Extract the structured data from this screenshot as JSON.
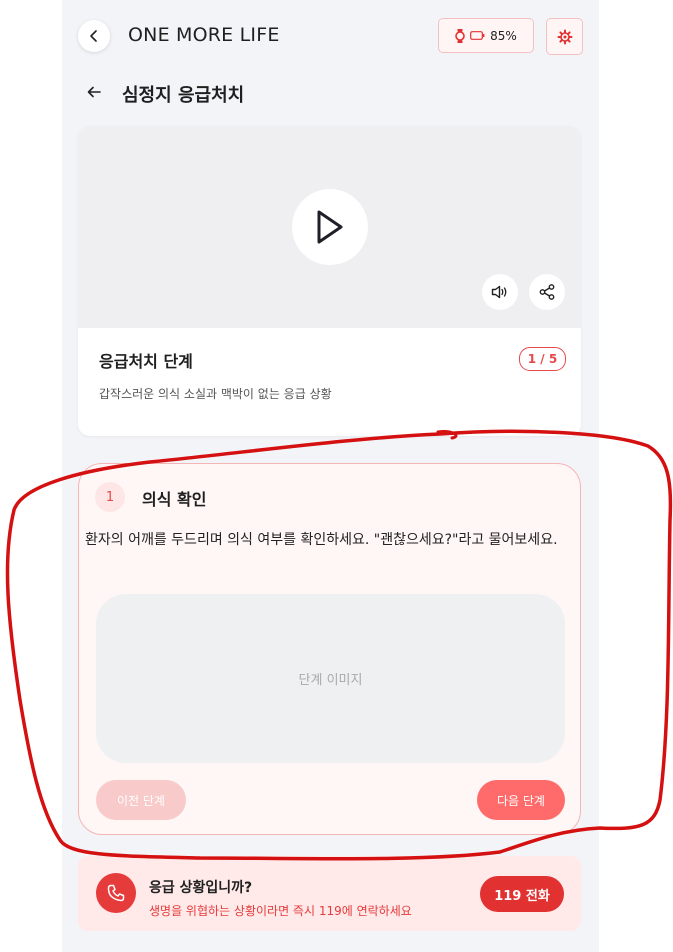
{
  "header": {
    "app_title": "ONE MORE LIFE",
    "battery_text": "85%",
    "battery_level": 0.85
  },
  "subnav": {
    "title": "심정지 응급처치"
  },
  "video_section": {
    "title": "응급처치 단계",
    "step_counter": "1 / 5",
    "description": "갑작스러운 의식 소실과 맥박이 없는 응급 상황"
  },
  "step": {
    "number": "1",
    "title": "의식 확인",
    "description": "환자의 어깨를 두드리며 의식 여부를 확인하세요. \"괜찮으세요?\"라고 물어보세요.",
    "image_placeholder": "단계 이미지",
    "prev_label": "이전 단계",
    "next_label": "다음 단계"
  },
  "emergency": {
    "title": "응급 상황입니까?",
    "description": "생명을 위협하는 상황이라면 즉시 119에 연락하세요",
    "call_label": "119 전화"
  },
  "colors": {
    "accent": "#e8494a",
    "annotation": "#d41010",
    "background": "#f3f4f8"
  },
  "icons": [
    "back-chevron-icon",
    "watch-icon",
    "battery-icon",
    "settings-gear-icon",
    "arrow-left-icon",
    "play-icon",
    "volume-icon",
    "share-icon",
    "phone-icon"
  ]
}
